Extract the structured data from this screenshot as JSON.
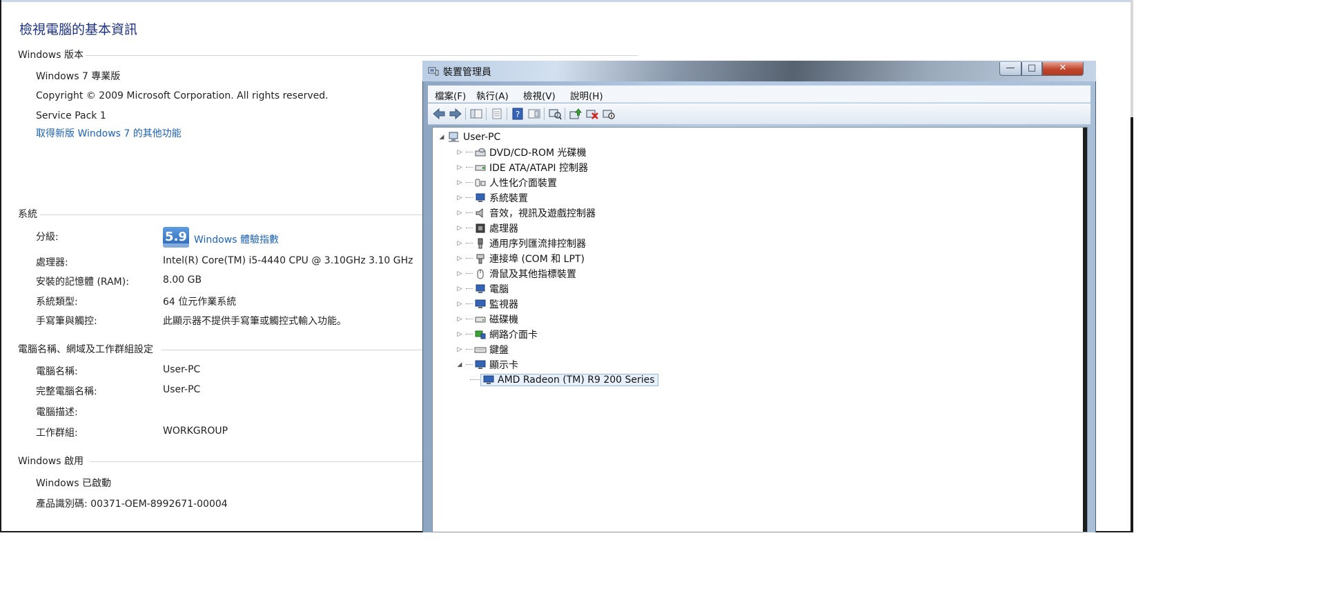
{
  "system": {
    "page_title": "檢視電腦的基本資訊",
    "edition": {
      "heading": "Windows 版本",
      "name": "Windows 7 專業版",
      "copyright": "Copyright © 2009 Microsoft Corporation.  All rights reserved.",
      "service_pack": "Service Pack 1",
      "upgrade_link": "取得新版 Windows 7 的其他功能"
    },
    "sys": {
      "heading": "系統",
      "rating_label": "分級:",
      "rating_score": "5.9",
      "rating_link": "Windows 體驗指數",
      "processor_label": "處理器:",
      "processor_value": "Intel(R) Core(TM) i5-4440 CPU @ 3.10GHz   3.10 GHz",
      "ram_label": "安裝的記憶體 (RAM):",
      "ram_value": "8.00 GB",
      "type_label": "系統類型:",
      "type_value": "64 位元作業系統",
      "pen_label": "手寫筆與觸控:",
      "pen_value": "此顯示器不提供手寫筆或觸控式輸入功能。"
    },
    "computer": {
      "heading": "電腦名稱、網域及工作群組設定",
      "name_label": "電腦名稱:",
      "name_value": "User-PC",
      "full_label": "完整電腦名稱:",
      "full_value": "User-PC",
      "desc_label": "電腦描述:",
      "group_label": "工作群組:",
      "group_value": "WORKGROUP"
    },
    "activation": {
      "heading": "Windows 啟用",
      "status": "Windows 已啟動",
      "product_id": "產品識別碼: 00371-OEM-8992671-00004"
    }
  },
  "device_manager": {
    "title": "裝置管理員",
    "window_buttons": {
      "minimize": "—",
      "maximize": "□",
      "close": "✕"
    },
    "menu": [
      "檔案(F)",
      "執行(A)",
      "檢視(V)",
      "說明(H)"
    ],
    "toolbar_icons": [
      "back-arrow-icon",
      "forward-arrow-icon",
      "console-tree-icon",
      "properties-icon",
      "help-icon",
      "view-icon",
      "scan-hardware-icon",
      "update-driver-icon",
      "uninstall-icon",
      "disable-icon"
    ],
    "root": "User-PC",
    "categories": [
      "DVD/CD-ROM 光碟機",
      "IDE ATA/ATAPI 控制器",
      "人性化介面裝置",
      "系統裝置",
      "音效，視訊及遊戲控制器",
      "處理器",
      "通用序列匯流排控制器",
      "連接埠 (COM 和 LPT)",
      "滑鼠及其他指標裝置",
      "電腦",
      "監視器",
      "磁碟機",
      "網路介面卡",
      "鍵盤",
      "顯示卡"
    ],
    "display_adapter": "AMD Radeon (TM) R9 200 Series"
  },
  "colors": {
    "link": "#1c62b9",
    "title": "#1e3287",
    "close_button": "#c0462d",
    "rating_badge": "#2a64b8"
  }
}
